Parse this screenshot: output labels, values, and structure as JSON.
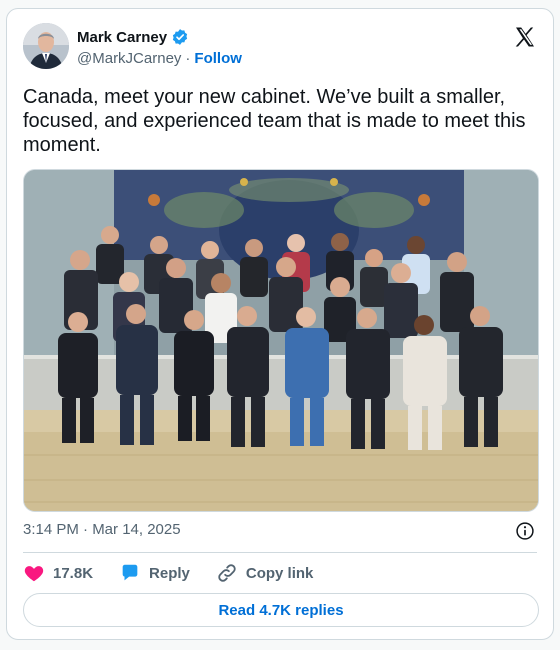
{
  "author": {
    "display_name": "Mark Carney",
    "handle": "@MarkJCarney",
    "separator": "·",
    "follow_label": "Follow",
    "verified_color": "#1d9bf0"
  },
  "tweet": {
    "text": "Canada, meet your new cabinet. We’ve built a smaller, focused, and experienced team that is made to meet this moment.",
    "timestamp": "3:14 PM · Mar 14, 2025"
  },
  "actions": {
    "like_count": "17.8K",
    "reply_label": "Reply",
    "copy_link_label": "Copy link"
  },
  "read_replies_label": "Read 4.7K replies",
  "icons": {
    "like": "heart-icon",
    "reply": "speech-bubble-icon",
    "copy": "link-icon",
    "info": "info-icon",
    "brand": "x-logo-icon"
  },
  "colors": {
    "accent": "#006fd6",
    "like": "#f91880",
    "reply": "#1d9bf0"
  }
}
